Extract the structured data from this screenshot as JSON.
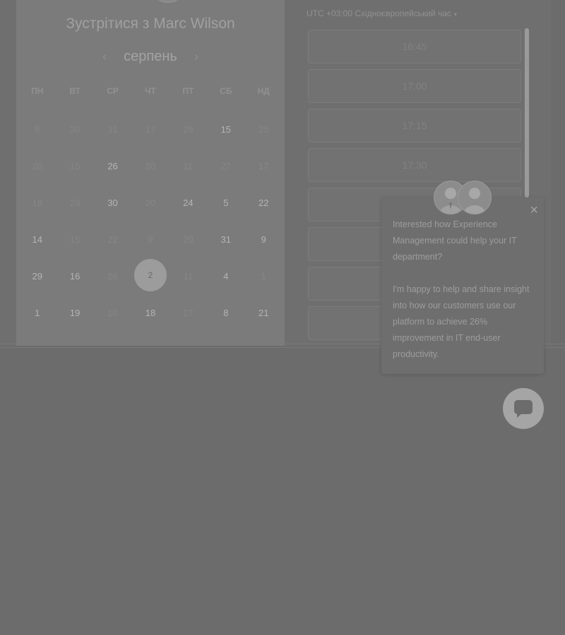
{
  "calendar": {
    "title": "Зустрітися з Marc Wilson",
    "month": "серпень",
    "prev_arrow": "‹",
    "next_arrow": "›",
    "weekdays": [
      "ПН",
      "ВТ",
      "СР",
      "ЧТ",
      "ПТ",
      "СБ",
      "НД"
    ],
    "weeks": [
      [
        {
          "d": "8",
          "s": "dim"
        },
        {
          "d": "30",
          "s": "dim"
        },
        {
          "d": "31",
          "s": "dim"
        },
        {
          "d": "17",
          "s": "dim"
        },
        {
          "d": "28",
          "s": "dim"
        },
        {
          "d": "15",
          "s": "act"
        },
        {
          "d": "25",
          "s": "dim"
        }
      ],
      [
        {
          "d": "20",
          "s": "dim"
        },
        {
          "d": "15",
          "s": "dim"
        },
        {
          "d": "26",
          "s": "act"
        },
        {
          "d": "20",
          "s": "dim"
        },
        {
          "d": "11",
          "s": "dim"
        },
        {
          "d": "27",
          "s": "dim"
        },
        {
          "d": "17",
          "s": "dim"
        }
      ],
      [
        {
          "d": "18",
          "s": "dim"
        },
        {
          "d": "29",
          "s": "dim"
        },
        {
          "d": "30",
          "s": "act"
        },
        {
          "d": "20",
          "s": "dim"
        },
        {
          "d": "24",
          "s": "act"
        },
        {
          "d": "5",
          "s": "act"
        },
        {
          "d": "22",
          "s": "act"
        }
      ],
      [
        {
          "d": "14",
          "s": "act"
        },
        {
          "d": "15",
          "s": "dim"
        },
        {
          "d": "22",
          "s": "dim"
        },
        {
          "d": "9",
          "s": "dim"
        },
        {
          "d": "20",
          "s": "dim"
        },
        {
          "d": "31",
          "s": "act"
        },
        {
          "d": "9",
          "s": "act"
        }
      ],
      [
        {
          "d": "29",
          "s": "act"
        },
        {
          "d": "16",
          "s": "act"
        },
        {
          "d": "26",
          "s": "dim"
        },
        {
          "d": "2",
          "s": "sel"
        },
        {
          "d": "11",
          "s": "dim"
        },
        {
          "d": "4",
          "s": "act"
        },
        {
          "d": "1",
          "s": "dim"
        }
      ],
      [
        {
          "d": "1",
          "s": "act"
        },
        {
          "d": "19",
          "s": "act"
        },
        {
          "d": "10",
          "s": "dim"
        },
        {
          "d": "18",
          "s": "act"
        },
        {
          "d": "27",
          "s": "dim"
        },
        {
          "d": "8",
          "s": "act"
        },
        {
          "d": "21",
          "s": "act"
        }
      ]
    ]
  },
  "timezone": {
    "label": "UTC +03:00 Східноєвропейський час",
    "caret": "▾"
  },
  "slots": [
    "16:45",
    "17:00",
    "17:15",
    "17:30",
    "",
    "",
    "",
    ""
  ],
  "chat": {
    "close": "×",
    "message_1": "Interested how Experience Management could help your IT department?",
    "message_2": "I'm happy to help and share insight into how our customers use our platform to achieve 26% improvement in IT end-user productivity."
  },
  "colors": {
    "overlay": "#6c6c6c",
    "panel": "#7b7b7b",
    "selected_day": "#9c9c9c"
  }
}
